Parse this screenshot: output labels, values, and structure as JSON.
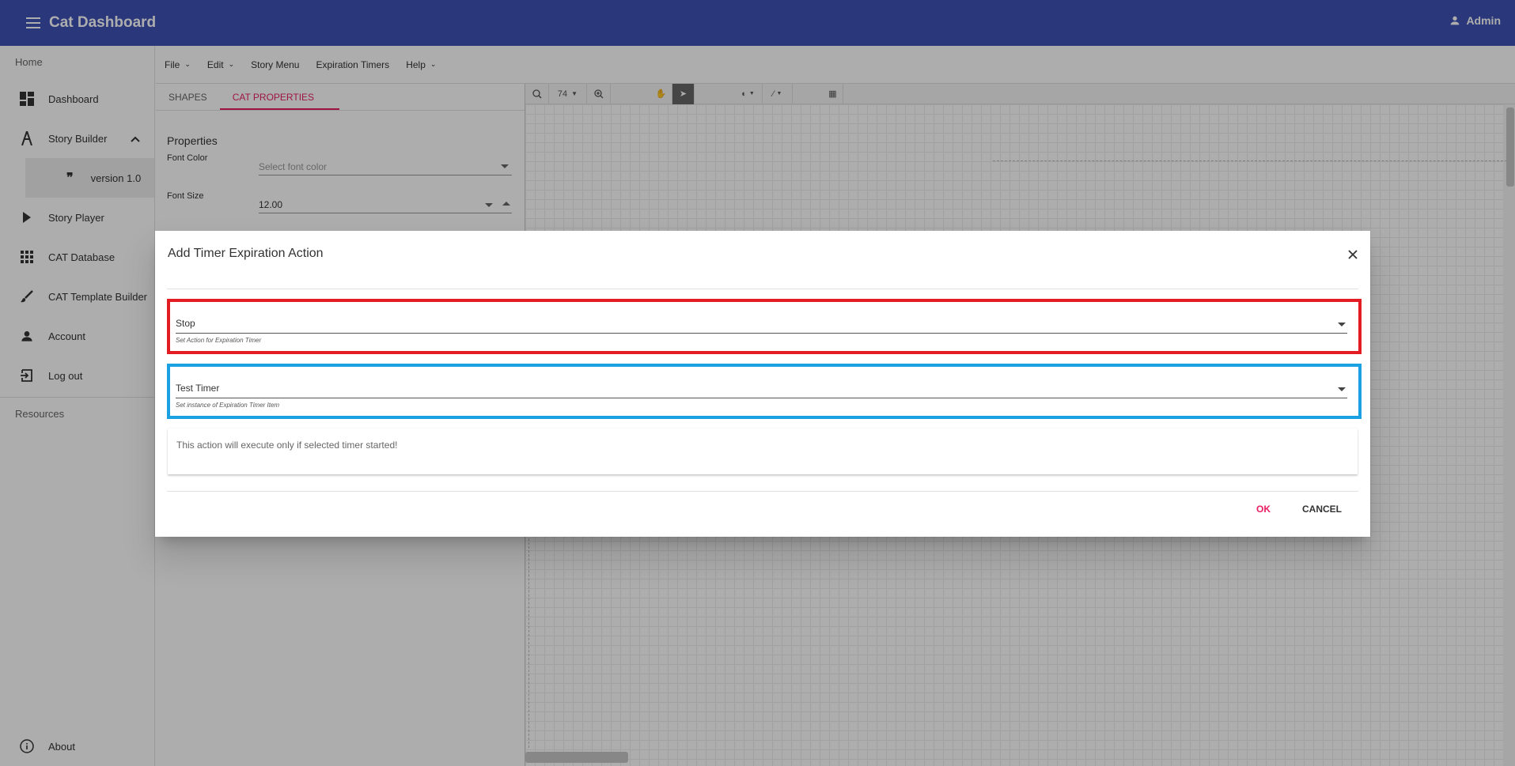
{
  "app": {
    "title": "Cat Dashboard",
    "user": "Admin"
  },
  "sidebar": {
    "home_section": "Home",
    "items": [
      {
        "label": "Dashboard",
        "icon": "dashboard-icon"
      },
      {
        "label": "Story Builder",
        "icon": "compass-icon"
      },
      {
        "label": "version 1.0",
        "icon": "quote-icon"
      },
      {
        "label": "Story Player",
        "icon": "play-icon"
      },
      {
        "label": "CAT Database",
        "icon": "apps-grid-icon"
      },
      {
        "label": "CAT Template Builder",
        "icon": "brush-icon"
      },
      {
        "label": "Account",
        "icon": "person-icon"
      },
      {
        "label": "Log out",
        "icon": "logout-icon"
      }
    ],
    "resources_section": "Resources",
    "about": "About"
  },
  "menubar": {
    "items": [
      "File",
      "Edit",
      "Story Menu",
      "Expiration Timers",
      "Help"
    ]
  },
  "leftpanel": {
    "tabs": [
      "SHAPES",
      "CAT PROPERTIES"
    ],
    "properties_title": "Properties",
    "font_color_label": "Font Color",
    "font_color_placeholder": "Select font color",
    "font_size_label": "Font Size",
    "font_size_value": "12.00"
  },
  "toolbar": {
    "zoom": "74"
  },
  "dialog": {
    "title": "Add Timer Expiration Action",
    "action_value": "Stop",
    "action_hint": "Set Action for Expiration Timer",
    "timer_value": "Test Timer",
    "timer_hint": "Set instance of Expiration Timer Item",
    "info": "This action will execute only if selected timer started!",
    "ok": "OK",
    "cancel": "CANCEL"
  },
  "colors": {
    "primary": "#3f51b5",
    "accent": "#e91e63",
    "highlight_red": "#e31b23",
    "highlight_blue": "#1ba1e2"
  }
}
